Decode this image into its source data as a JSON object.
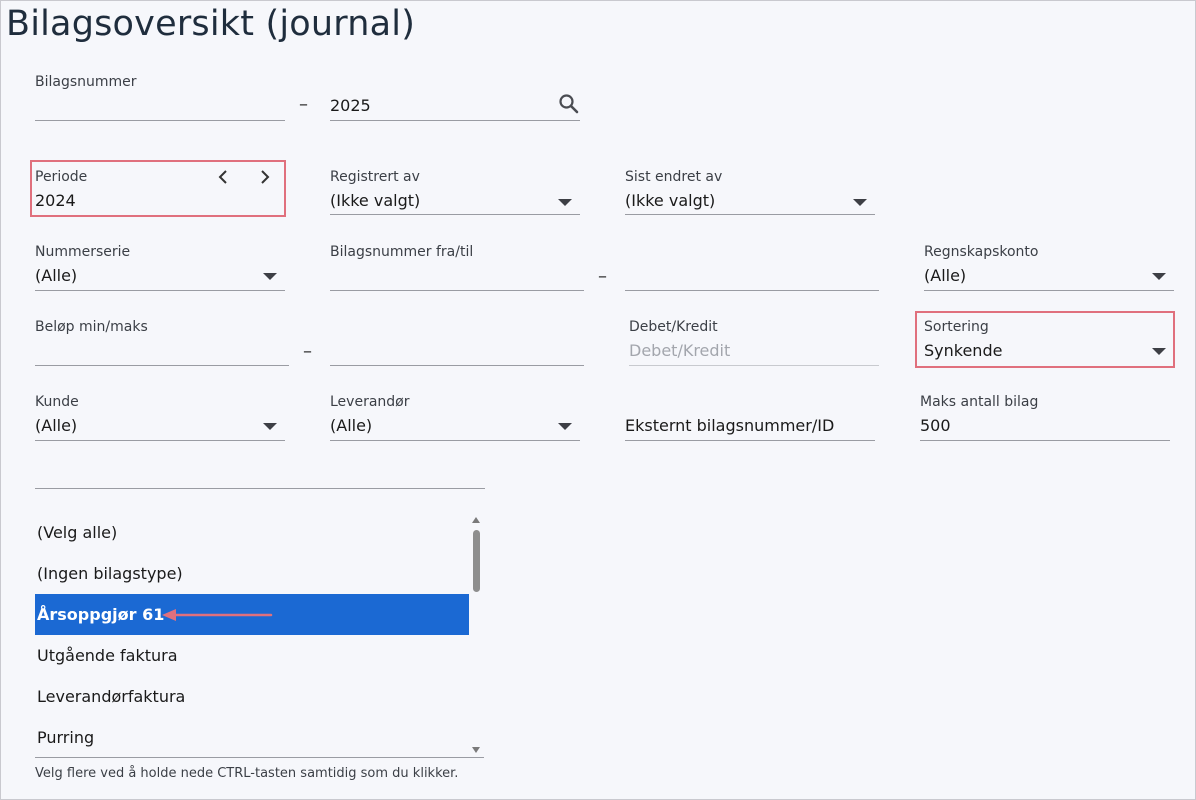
{
  "page": {
    "title": "Bilagsoversikt (journal)"
  },
  "bilagsnummer": {
    "label": "Bilagsnummer",
    "from": "",
    "to": "2025",
    "search_icon": "search-icon"
  },
  "periode": {
    "label": "Periode",
    "value": "2024",
    "prev_icon": "chevron-left-icon",
    "next_icon": "chevron-right-icon"
  },
  "registrert_av": {
    "label": "Registrert av",
    "value": "(Ikke valgt)"
  },
  "sist_endret_av": {
    "label": "Sist endret av",
    "value": "(Ikke valgt)"
  },
  "nummerserie": {
    "label": "Nummerserie",
    "value": "(Alle)"
  },
  "bilagsnummer_fra_til": {
    "label": "Bilagsnummer fra/til",
    "from": "",
    "to": ""
  },
  "regnskapskonto": {
    "label": "Regnskapskonto",
    "value": "(Alle)"
  },
  "belop": {
    "label": "Beløp min/maks",
    "min": "",
    "max": ""
  },
  "debet_kredit": {
    "label": "Debet/Kredit",
    "placeholder": "Debet/Kredit"
  },
  "sortering": {
    "label": "Sortering",
    "value": "Synkende"
  },
  "kunde": {
    "label": "Kunde",
    "value": "(Alle)"
  },
  "leverandor": {
    "label": "Leverandør",
    "value": "(Alle)"
  },
  "eksternt": {
    "placeholder": "Eksternt bilagsnummer/ID"
  },
  "maks_antall": {
    "label": "Maks antall bilag",
    "value": "500"
  },
  "free_text": {
    "value": ""
  },
  "bilagstyper": {
    "items": [
      "(Velg alle)",
      "(Ingen bilagstype)",
      "Årsoppgjør 61",
      "Utgående faktura",
      "Leverandørfaktura",
      "Purring"
    ],
    "selected_index": 2
  },
  "hint": "Velg flere ved å holde nede CTRL-tasten samtidig som du klikker.",
  "colors": {
    "selected": "#1b69d3",
    "highlight": "#e0707d",
    "arrow": "#e0707d"
  }
}
